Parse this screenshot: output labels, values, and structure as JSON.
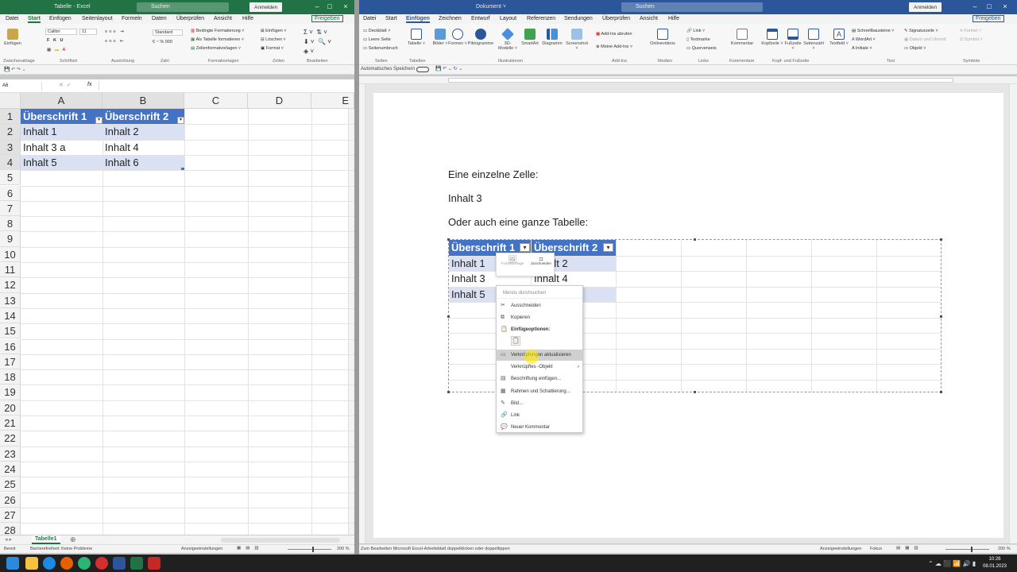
{
  "excel": {
    "title": "Tabelle - Excel",
    "search": "Suchen",
    "login": "Anmelden",
    "share": "Freigeben",
    "tabs": [
      "Datei",
      "Start",
      "Einfügen",
      "Seitenlayout",
      "Formeln",
      "Daten",
      "Überprüfen",
      "Ansicht",
      "Hilfe"
    ],
    "ribbon": {
      "paste": "Einfügen",
      "font": "Calibri",
      "size": "11",
      "number_format": "Standard",
      "cond_format": "Bedingte Formatierung",
      "as_table": "Als Tabelle formatieren",
      "cell_styles": "Zellenformatvorlagen",
      "insert": "Einfügen",
      "delete": "Löschen",
      "format": "Format",
      "groups": [
        "Zwischenablage",
        "Schriftart",
        "Ausrichtung",
        "Zahl",
        "Formatvorlagen",
        "Zellen",
        "Bearbeiten"
      ]
    },
    "name_box": "A6",
    "fx": "fx",
    "columns": [
      "A",
      "B",
      "C",
      "D",
      "E"
    ],
    "rows": [
      "1",
      "2",
      "3",
      "4",
      "5",
      "6",
      "7",
      "8",
      "9",
      "10",
      "11",
      "12",
      "13",
      "14",
      "15",
      "16",
      "17",
      "18",
      "19",
      "20",
      "21",
      "22",
      "23",
      "24",
      "25",
      "26",
      "27",
      "28"
    ],
    "table": [
      [
        "Überschrift 1",
        "Überschrift 2"
      ],
      [
        "Inhalt 1",
        "Inhalt 2"
      ],
      [
        "Inhalt 3 a",
        "Inhalt 4"
      ],
      [
        "Inhalt 5",
        "Inhalt 6"
      ]
    ],
    "sheet_tab": "Tabelle1",
    "status_ready": "Bereit",
    "status_access": "Barrierefreiheit: Keine Probleme",
    "status_display": "Anzeigeeinstellungen",
    "zoom": "200 %"
  },
  "word": {
    "title": "Dokument",
    "search": "Suchen",
    "login": "Anmelden",
    "share": "Freigeben",
    "tabs": [
      "Datei",
      "Start",
      "Einfügen",
      "Zeichnen",
      "Entwurf",
      "Layout",
      "Referenzen",
      "Sendungen",
      "Überprüfen",
      "Ansicht",
      "Hilfe"
    ],
    "ribbon": {
      "pages": [
        "Deckblatt",
        "Leere Seite",
        "Seitenumbruch"
      ],
      "buttons": [
        "Tabelle",
        "Bilder",
        "Formen",
        "Piktogramme",
        "3D-Modelle",
        "SmartArt",
        "Diagramm",
        "Screenshot"
      ],
      "addins": [
        "Add-Ins abrufen",
        "Meine Add-Ins"
      ],
      "online_videos": "Onlinevideos",
      "links": [
        "Link",
        "Textmarke",
        "Querverweis"
      ],
      "comment": "Kommentar",
      "header_footer": [
        "Kopfzeile",
        "Fußzeile",
        "Seitenzahl"
      ],
      "textfield": "Textfeld",
      "text_items": [
        "Schnellbausteine",
        "WordArt",
        "Initiale"
      ],
      "text_items2": [
        "Signaturzeile",
        "Datum und Uhrzeit",
        "Objekt"
      ],
      "symbols": [
        "Formel",
        "Symbol"
      ],
      "groups": [
        "Seiten",
        "Tabellen",
        "Illustrationen",
        "Add-Ins",
        "Medien",
        "Links",
        "Kommentare",
        "Kopf- und Fußzeile",
        "Text",
        "Symbole"
      ]
    },
    "autosave": "Automatisches Speichern",
    "body": {
      "line1": "Eine einzelne Zelle:",
      "line2": "Inhalt 3",
      "line3": "Oder auch eine ganze Tabelle:"
    },
    "table": [
      [
        "Überschrift 1",
        "Überschrift 2"
      ],
      [
        "Inhalt 1",
        "Inhalt 2"
      ],
      [
        "Inhalt 3",
        "Inhalt 4"
      ],
      [
        "Inhalt 5",
        ""
      ]
    ],
    "mini_toolbar": [
      "Formatvorlage",
      "Zuschneiden"
    ],
    "context_menu": {
      "search": "Menüs durchsuchen",
      "items": [
        "Ausschneiden",
        "Kopieren",
        "Einfügeoptionen:",
        "Verknüpfungen aktualisieren",
        "Verknüpftes -Objekt",
        "Beschriftung einfügen...",
        "Rahmen und Schattierung...",
        "Bild...",
        "Link",
        "Neuer Kommentar"
      ]
    },
    "status_hint": "Zum Bearbeiten Microsoft Excel-Arbeitsblatt doppelklicken oder doppeltippen",
    "status_display": "Anzeigeeinstellungen",
    "focus": "Fokus",
    "zoom": "200 %"
  },
  "taskbar": {
    "time": "10:26",
    "date": "08.01.2023"
  },
  "colors": {
    "excel": "#217346",
    "word": "#2b579a",
    "table_header": "#4472c4",
    "table_band": "#d9e1f2"
  }
}
